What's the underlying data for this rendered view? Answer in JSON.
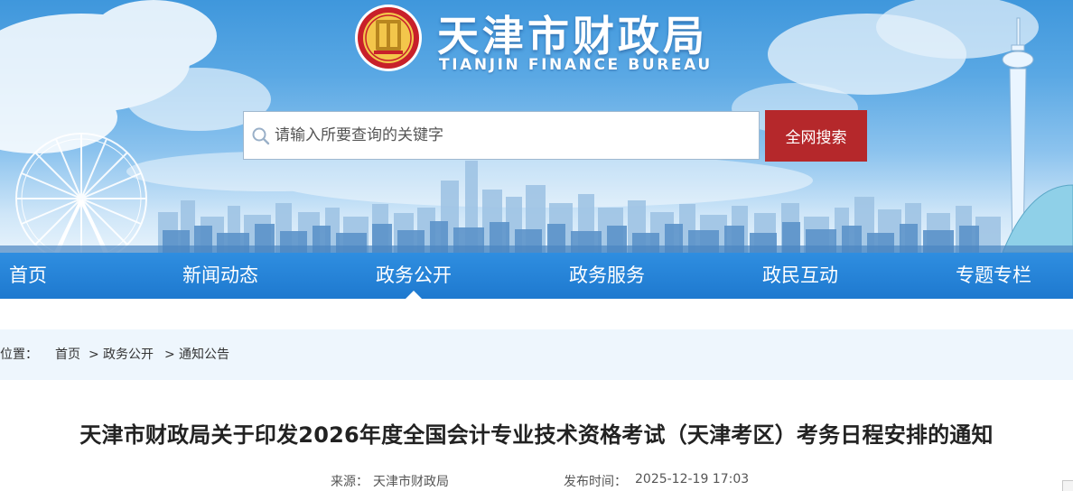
{
  "header": {
    "title": "天津市财政局",
    "subtitle": "TIANJIN FINANCE BUREAU",
    "emblem_icon": "tianjin-finance-emblem",
    "search": {
      "placeholder": "请输入所要查询的关键字",
      "value": "",
      "button_label": "全网搜索"
    }
  },
  "nav": {
    "items": [
      {
        "label": "首页",
        "active": false
      },
      {
        "label": "新闻动态",
        "active": false
      },
      {
        "label": "政务公开",
        "active": true
      },
      {
        "label": "政务服务",
        "active": false
      },
      {
        "label": "政民互动",
        "active": false
      },
      {
        "label": "专题专栏",
        "active": false
      }
    ]
  },
  "breadcrumb": {
    "prefix": "前位置：",
    "items": [
      "首页",
      "政务公开",
      "通知公告"
    ],
    "separator": ">"
  },
  "article": {
    "title": "天津市财政局关于印发2026年度全国会计专业技术资格考试（天津考区）考务日程安排的通知",
    "source_label": "来源：",
    "source": "天津市财政局",
    "date_label": "发布时间：",
    "date": "2025-12-19 17:03"
  },
  "colors": {
    "nav_bg": "#1e79cf",
    "search_button": "#b5282b",
    "breadcrumb_bg": "#eef6fd"
  }
}
